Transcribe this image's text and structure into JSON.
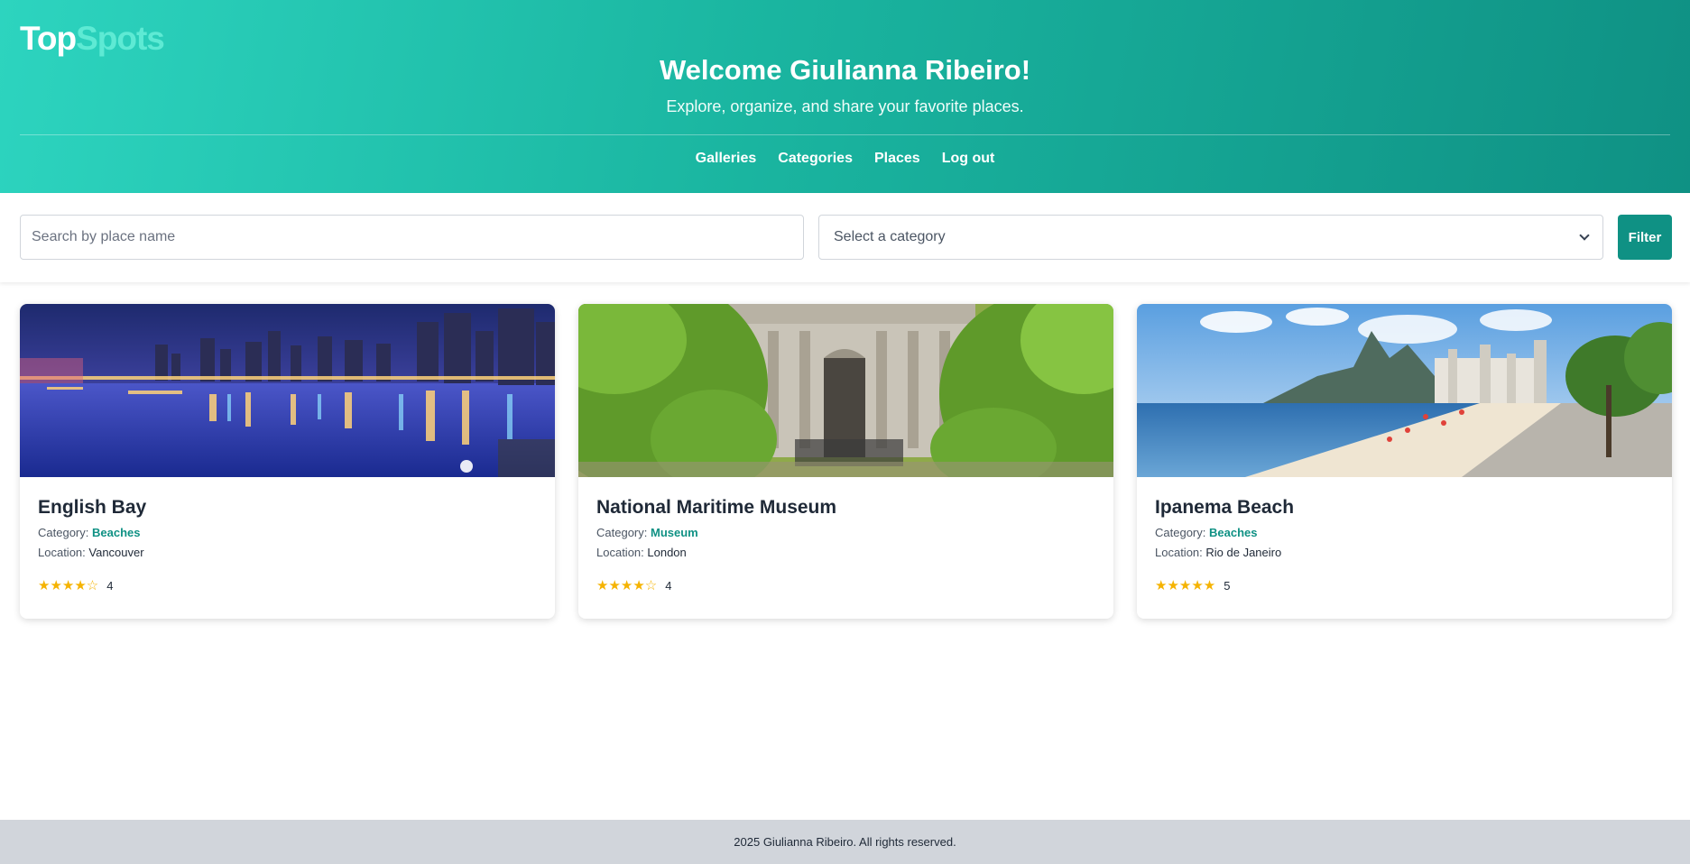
{
  "brand": {
    "part1": "Top",
    "part2": "Spots"
  },
  "header": {
    "welcome": "Welcome Giulianna Ribeiro!",
    "subtitle": "Explore, organize, and share your favorite places."
  },
  "nav": {
    "galleries": "Galleries",
    "categories": "Categories",
    "places": "Places",
    "logout": "Log out"
  },
  "filters": {
    "search_placeholder": "Search by place name",
    "category_selected": "Select a category",
    "filter_label": "Filter"
  },
  "labels": {
    "category": "Category:",
    "location": "Location:"
  },
  "cards": [
    {
      "title": "English Bay",
      "category": "Beaches",
      "location": "Vancouver",
      "stars": "★★★★☆",
      "rating": "4"
    },
    {
      "title": "National Maritime Museum",
      "category": "Museum",
      "location": "London",
      "stars": "★★★★☆",
      "rating": "4"
    },
    {
      "title": "Ipanema Beach",
      "category": "Beaches",
      "location": "Rio de Janeiro",
      "stars": "★★★★★",
      "rating": "5"
    }
  ],
  "footer": {
    "text": "2025 Giulianna Ribeiro. All rights reserved."
  },
  "colors": {
    "accent": "#0f9184",
    "header_start": "#2dd4bf",
    "star": "#f5b301",
    "footer_bg": "#d1d5db"
  }
}
